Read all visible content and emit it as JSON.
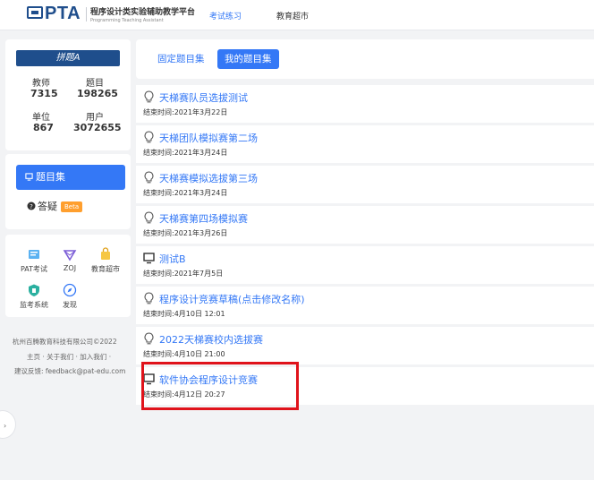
{
  "header": {
    "brand": "PTA",
    "subtitle": "程序设计类实验辅助教学平台",
    "subtitle_en": "Programming Teaching Assistant",
    "nav": [
      {
        "label": "考试练习"
      },
      {
        "label": "教育超市"
      }
    ]
  },
  "profile": {
    "banner": "拼题A",
    "stats": [
      {
        "label": "教师",
        "value": "7315"
      },
      {
        "label": "题目",
        "value": "198265"
      },
      {
        "label": "单位",
        "value": "867"
      },
      {
        "label": "用户",
        "value": "3072655"
      }
    ]
  },
  "menu": {
    "active": "题目集",
    "qa": "答疑",
    "beta": "Beta"
  },
  "tools": [
    {
      "label": "PAT考试",
      "icon": "pat-icon"
    },
    {
      "label": "ZOJ",
      "icon": "zoj-icon"
    },
    {
      "label": "教育超市",
      "icon": "market-icon"
    },
    {
      "label": "监考系统",
      "icon": "proctor-icon"
    },
    {
      "label": "发现",
      "icon": "discover-icon"
    }
  ],
  "footer": {
    "company": "杭州百腾教育科技有限公司©2022",
    "links": "主页 · 关于我们 · 加入我们 ·",
    "feedback": "建议反馈: feedback@pat-edu.com"
  },
  "tabs": [
    {
      "label": "固定题目集"
    },
    {
      "label": "我的题目集"
    }
  ],
  "items": [
    {
      "title": "天梯赛队员选拔测试",
      "time": "结束时间:2021年3月22日",
      "icon": "lightbulb-icon"
    },
    {
      "title": "天梯团队模拟赛第二场",
      "time": "结束时间:2021年3月24日",
      "icon": "lightbulb-icon"
    },
    {
      "title": "天梯赛模拟选拔第三场",
      "time": "结束时间:2021年3月24日",
      "icon": "lightbulb-icon"
    },
    {
      "title": "天梯赛第四场模拟赛",
      "time": "结束时间:2021年3月26日",
      "icon": "lightbulb-icon"
    },
    {
      "title": "测试B",
      "time": "结束时间:2021年7月5日",
      "icon": "monitor-icon"
    },
    {
      "title": "程序设计竞赛草稿(点击修改名称)",
      "time": "结束时间:4月10日 12:01",
      "icon": "lightbulb-icon"
    },
    {
      "title": "2022天梯赛校内选拔赛",
      "time": "结束时间:4月10日 21:00",
      "icon": "lightbulb-icon"
    },
    {
      "title": "软件协会程序设计竞赛",
      "time": "结束时间:4月12日 20:27",
      "icon": "monitor-icon"
    }
  ],
  "colors": {
    "primary": "#3478f6",
    "brand": "#1f4e8c",
    "highlight": "#e0131b",
    "beta": "#ff9f2e"
  }
}
